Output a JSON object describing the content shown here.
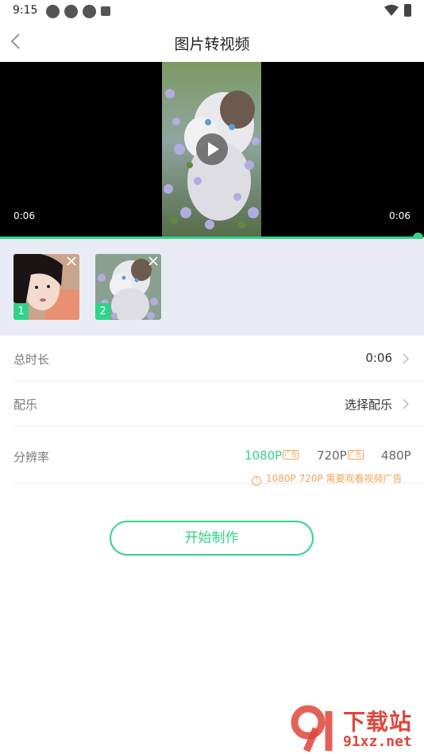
{
  "status_bar": {
    "time": "9:15"
  },
  "header": {
    "title": "图片转视频",
    "back_icon": "chevron-left-icon"
  },
  "player": {
    "current_time": "0:06",
    "total_time": "0:06",
    "progress": 1.0,
    "accent_color": "#2fd48a"
  },
  "thumbnails": [
    {
      "index": "1",
      "subject": "portrait photo"
    },
    {
      "index": "2",
      "subject": "cat among flowers"
    }
  ],
  "settings": {
    "duration": {
      "label": "总时长",
      "value": "0:06"
    },
    "music": {
      "label": "配乐",
      "value": "选择配乐"
    },
    "resolution": {
      "label": "分辨率",
      "options": [
        {
          "label": "1080P",
          "badge": "广告",
          "selected": true
        },
        {
          "label": "720P",
          "badge": "广告",
          "selected": false
        },
        {
          "label": "480P",
          "badge": "",
          "selected": false
        }
      ],
      "note": "1080P 720P 需要观看视频广告",
      "note_icon": "!"
    }
  },
  "start_button": {
    "label": "开始制作"
  },
  "watermark": {
    "title": "下载站",
    "url": "91xz.net"
  }
}
